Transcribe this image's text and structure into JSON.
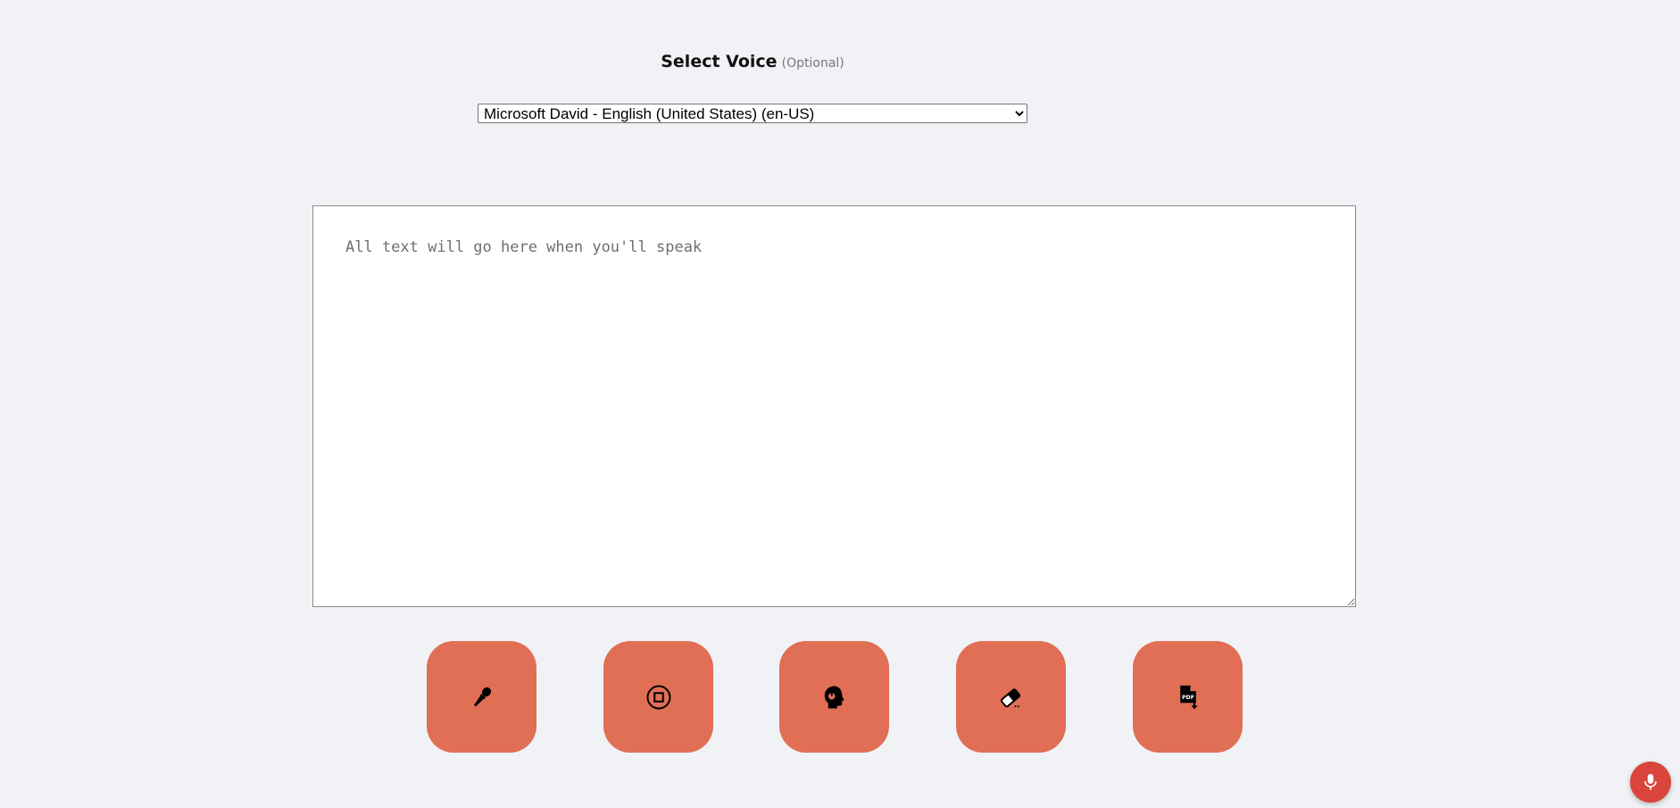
{
  "voice": {
    "title": "Select Voice",
    "optional": "(Optional)",
    "selected": "Microsoft David - English (United States) (en-US)"
  },
  "transcript": {
    "placeholder": "All text will go here when you'll speak"
  },
  "colors": {
    "background": "#f0f2f5",
    "button": "#e06f55",
    "fab": "#d9453c"
  },
  "actions": [
    {
      "name": "microphone",
      "icon": "microphone-icon"
    },
    {
      "name": "stop",
      "icon": "stop-icon"
    },
    {
      "name": "listen",
      "icon": "headset-icon"
    },
    {
      "name": "clear",
      "icon": "eraser-icon"
    },
    {
      "name": "pdf",
      "icon": "pdf-download-icon"
    }
  ],
  "fab": {
    "icon": "microphone-icon"
  }
}
